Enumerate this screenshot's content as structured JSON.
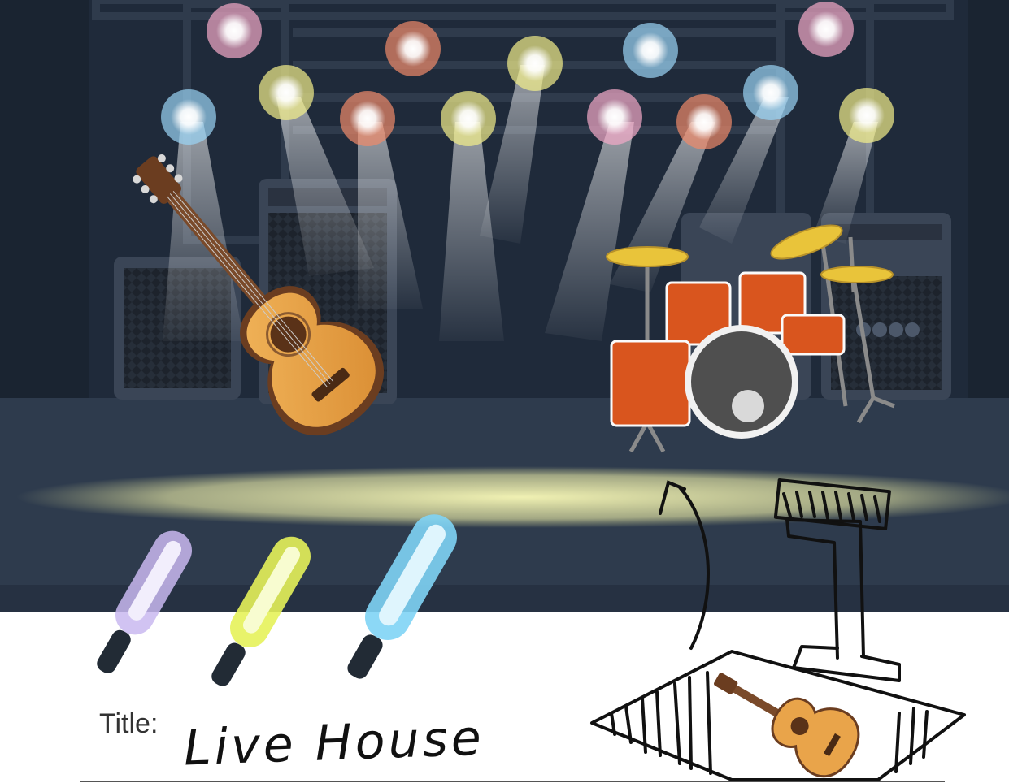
{
  "title": {
    "label": "Title:",
    "value": "Live House"
  },
  "palette": {
    "stage_background": "#1f2a3a",
    "floor": "#2e3b4d",
    "spotlight_beam": "#f5f5b0",
    "light_colors": [
      "#f4a9c8",
      "#f3f08a",
      "#f08a6a",
      "#9ad4f5"
    ],
    "glow_sticks": [
      "#c9b8f0",
      "#e6f25a",
      "#7fd4f5"
    ],
    "drum_shells": "#d9551e",
    "cymbals": "#e9c43a",
    "guitar_body": "#e9a44a"
  },
  "icons": [
    "spotlight-icon",
    "amplifier-icon",
    "guitar-icon",
    "drum-kit-icon",
    "glow-stick-icon",
    "arrow-icon",
    "stage-sketch-icon"
  ]
}
